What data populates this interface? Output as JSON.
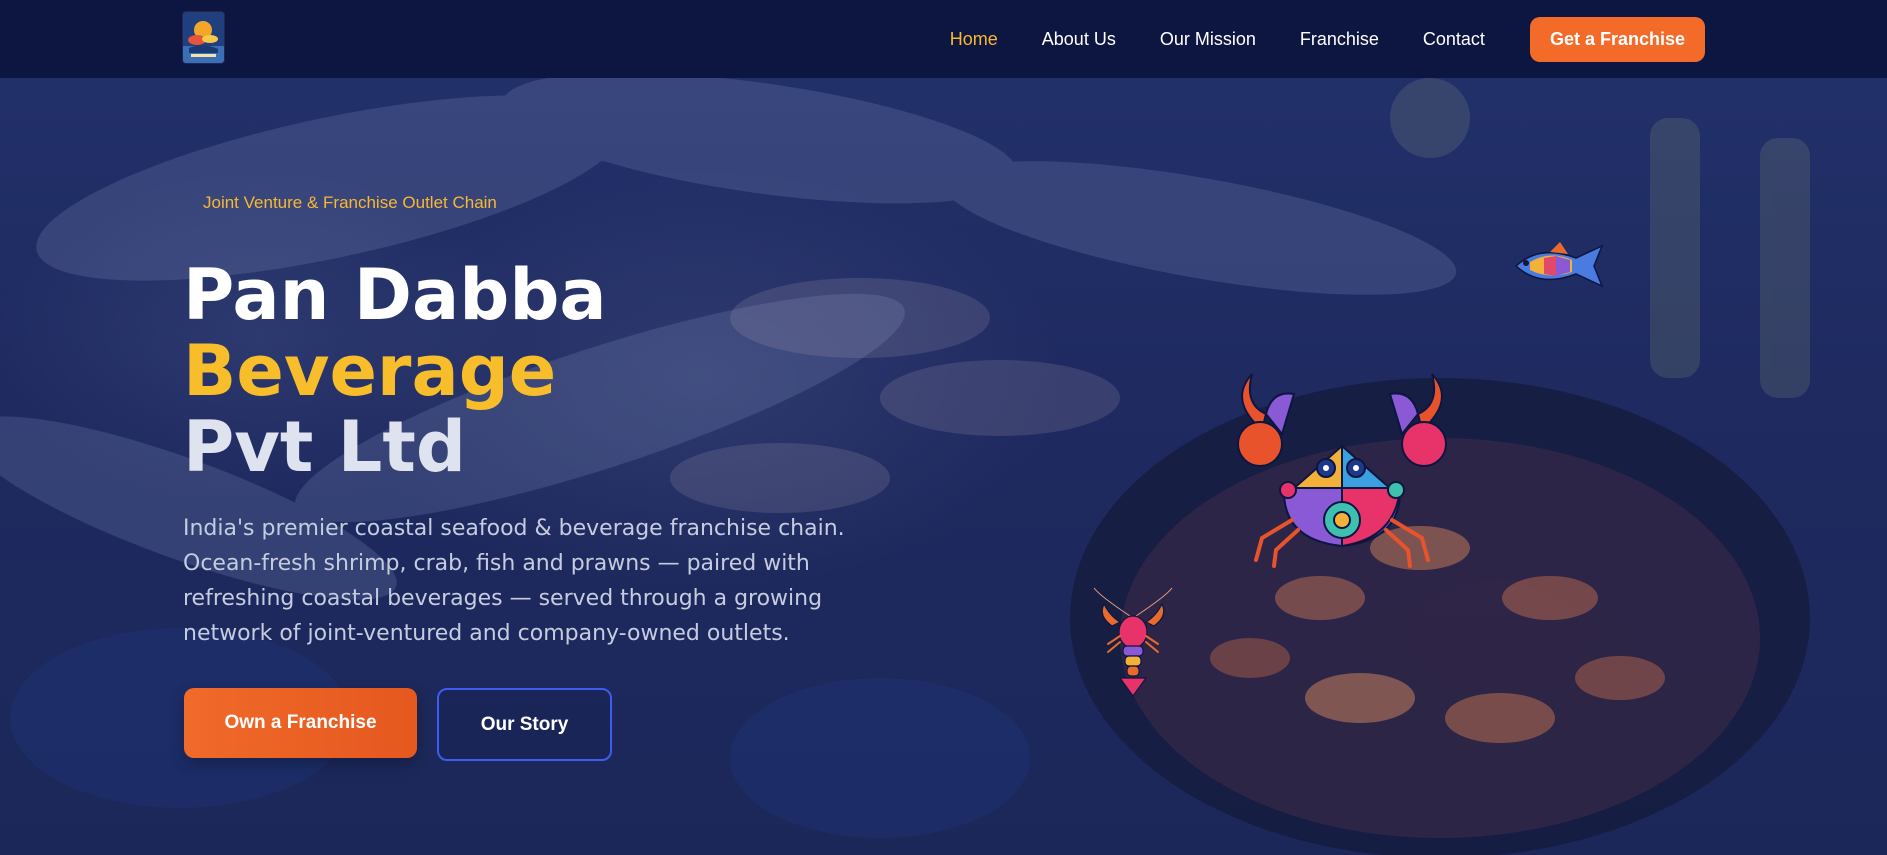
{
  "brand": {
    "logo_icon": "company-logo-icon"
  },
  "nav": {
    "links": [
      {
        "label": "Home",
        "active": true
      },
      {
        "label": "About Us",
        "active": false
      },
      {
        "label": "Our Mission",
        "active": false
      },
      {
        "label": "Franchise",
        "active": false
      },
      {
        "label": "Contact",
        "active": false
      }
    ],
    "cta_label": "Get a Franchise"
  },
  "hero": {
    "tagline": "Joint Venture & Franchise Outlet Chain",
    "title_line1": "Pan Dabba",
    "title_line2": "Beverage",
    "title_line3": "Pvt Ltd",
    "description": "India's premier coastal seafood & beverage franchise chain. Ocean-fresh shrimp, crab, fish and prawns — paired with refreshing coastal beverages — served through a growing network of joint-ventured and company-owned outlets.",
    "primary_button": "Own a Franchise",
    "secondary_button": "Our Story",
    "illustrations": [
      "fish-illustration-icon",
      "crab-illustration-icon",
      "lobster-illustration-icon"
    ]
  },
  "colors": {
    "nav_bg": "#0d1640",
    "accent_yellow": "#f8b830",
    "accent_orange": "#f46a28",
    "hero_bg": "#1e2a60",
    "outline_blue": "#3d5cf0"
  }
}
